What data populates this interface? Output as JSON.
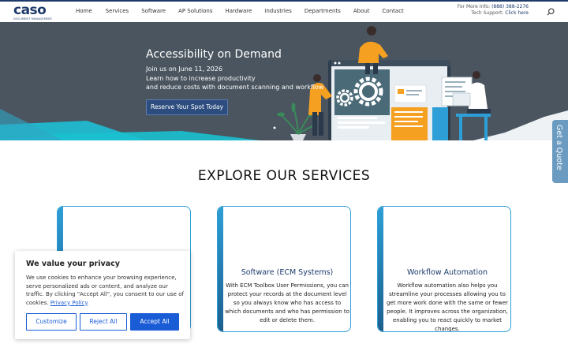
{
  "header": {
    "logo_text": "caso",
    "logo_tagline": "DOCUMENT MANAGEMENT",
    "nav": [
      "Home",
      "Services",
      "Software",
      "AP Solutions",
      "Hardware",
      "Industries",
      "Departments",
      "About",
      "Contact"
    ],
    "contact_info_label": "For More Info:",
    "contact_phone": "(888) 388-2276",
    "tech_support_label": "Tech Support:",
    "tech_support_link": "Click here",
    "search_icon": "search-icon"
  },
  "hero": {
    "title": "Accessibility on Demand",
    "date_line": "Join us on June 11, 2026",
    "desc_line1": "Learn how to increase productivity",
    "desc_line2": "and reduce costs with document scanning and workflow",
    "cta": "Reserve Your Spot Today"
  },
  "quote_tab": "Get a Quote",
  "services": {
    "title": "EXPLORE OUR SERVICES",
    "cards": [
      {
        "title": "",
        "text": ""
      },
      {
        "title": "Software (ECM Systems)",
        "text": "With ECM Toolbox User Permissions, you can protect your records at the document level so you always know who has access to which documents and who has permission to edit or delete them."
      },
      {
        "title": "Workflow Automation",
        "text": "Workflow automation also helps you streamline your processes allowing you to get more work done with the same or fewer people. It improves across the organization, enabling you to react quickly to market changes."
      }
    ]
  },
  "cookie": {
    "heading": "We value your privacy",
    "body": "We use cookies to enhance your browsing experience, serve personalized ads or content, and analyze our traffic. By clicking \"Accept All\", you consent to our use of cookies.",
    "policy_link": "Privacy Policy",
    "btn_customize": "Customize",
    "btn_reject": "Reject All",
    "btn_accept": "Accept All"
  },
  "colors": {
    "brand_navy": "#1d3a6b",
    "accent_blue": "#2d9fd6",
    "cookie_blue": "#1a5cd6",
    "hero_bg": "#4a5560",
    "quote_tab": "#6b9bc0",
    "illustration_orange": "#f5a021"
  }
}
